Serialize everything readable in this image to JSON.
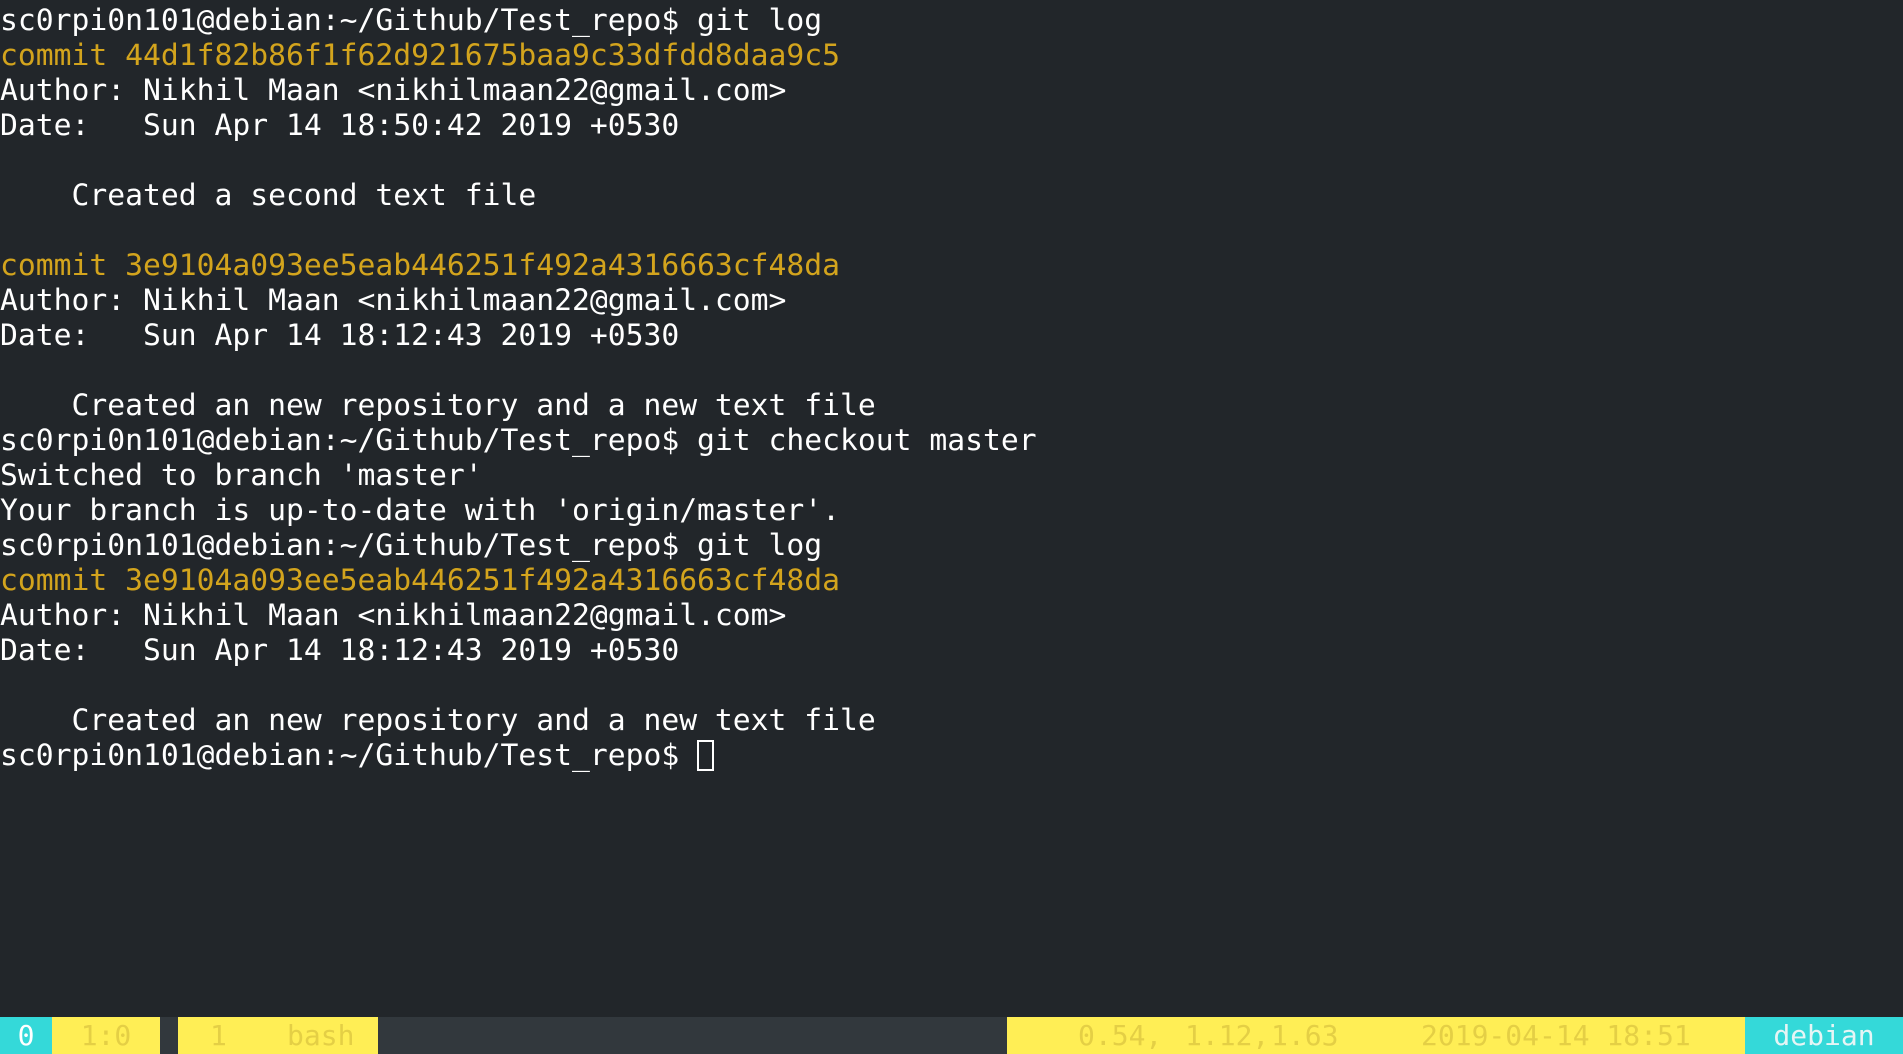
{
  "terminal": {
    "lines": [
      "sc0rpi0n101@debian:~/Github/Test_repo$ git log",
      "commit 44d1f82b86f1f62d921675baa9c33dfdd8daa9c5",
      "Author: Nikhil Maan <nikhilmaan22@gmail.com>",
      "Date:   Sun Apr 14 18:50:42 2019 +0530",
      "",
      "    Created a second text file",
      "",
      "commit 3e9104a093ee5eab446251f492a4316663cf48da",
      "Author: Nikhil Maan <nikhilmaan22@gmail.com>",
      "Date:   Sun Apr 14 18:12:43 2019 +0530",
      "",
      "    Created an new repository and a new text file",
      "sc0rpi0n101@debian:~/Github/Test_repo$ git checkout master",
      "Switched to branch 'master'",
      "Your branch is up-to-date with 'origin/master'.",
      "sc0rpi0n101@debian:~/Github/Test_repo$ git log",
      "commit 3e9104a093ee5eab446251f492a4316663cf48da",
      "Author: Nikhil Maan <nikhilmaan22@gmail.com>",
      "Date:   Sun Apr 14 18:12:43 2019 +0530",
      "",
      "    Created an new repository and a new text file"
    ],
    "prompt": "sc0rpi0n101@debian:~/Github/Test_repo$ ",
    "colors": {
      "background": "#22262a",
      "text": "#ffffff",
      "commit_hash": "#d3a41d"
    }
  },
  "statusbar": {
    "session": "0",
    "pane": "1:0",
    "window_index": "1",
    "window_name": "bash",
    "load_1": "0.54,",
    "load_5": "1.12,",
    "load_15": "1.63",
    "datetime": "2019-04-14 18:51",
    "hostname": "debian",
    "colors": {
      "accent_cyan": "#34d9d9",
      "accent_yellow": "#ffee55",
      "bar_background": "#32383d"
    }
  }
}
